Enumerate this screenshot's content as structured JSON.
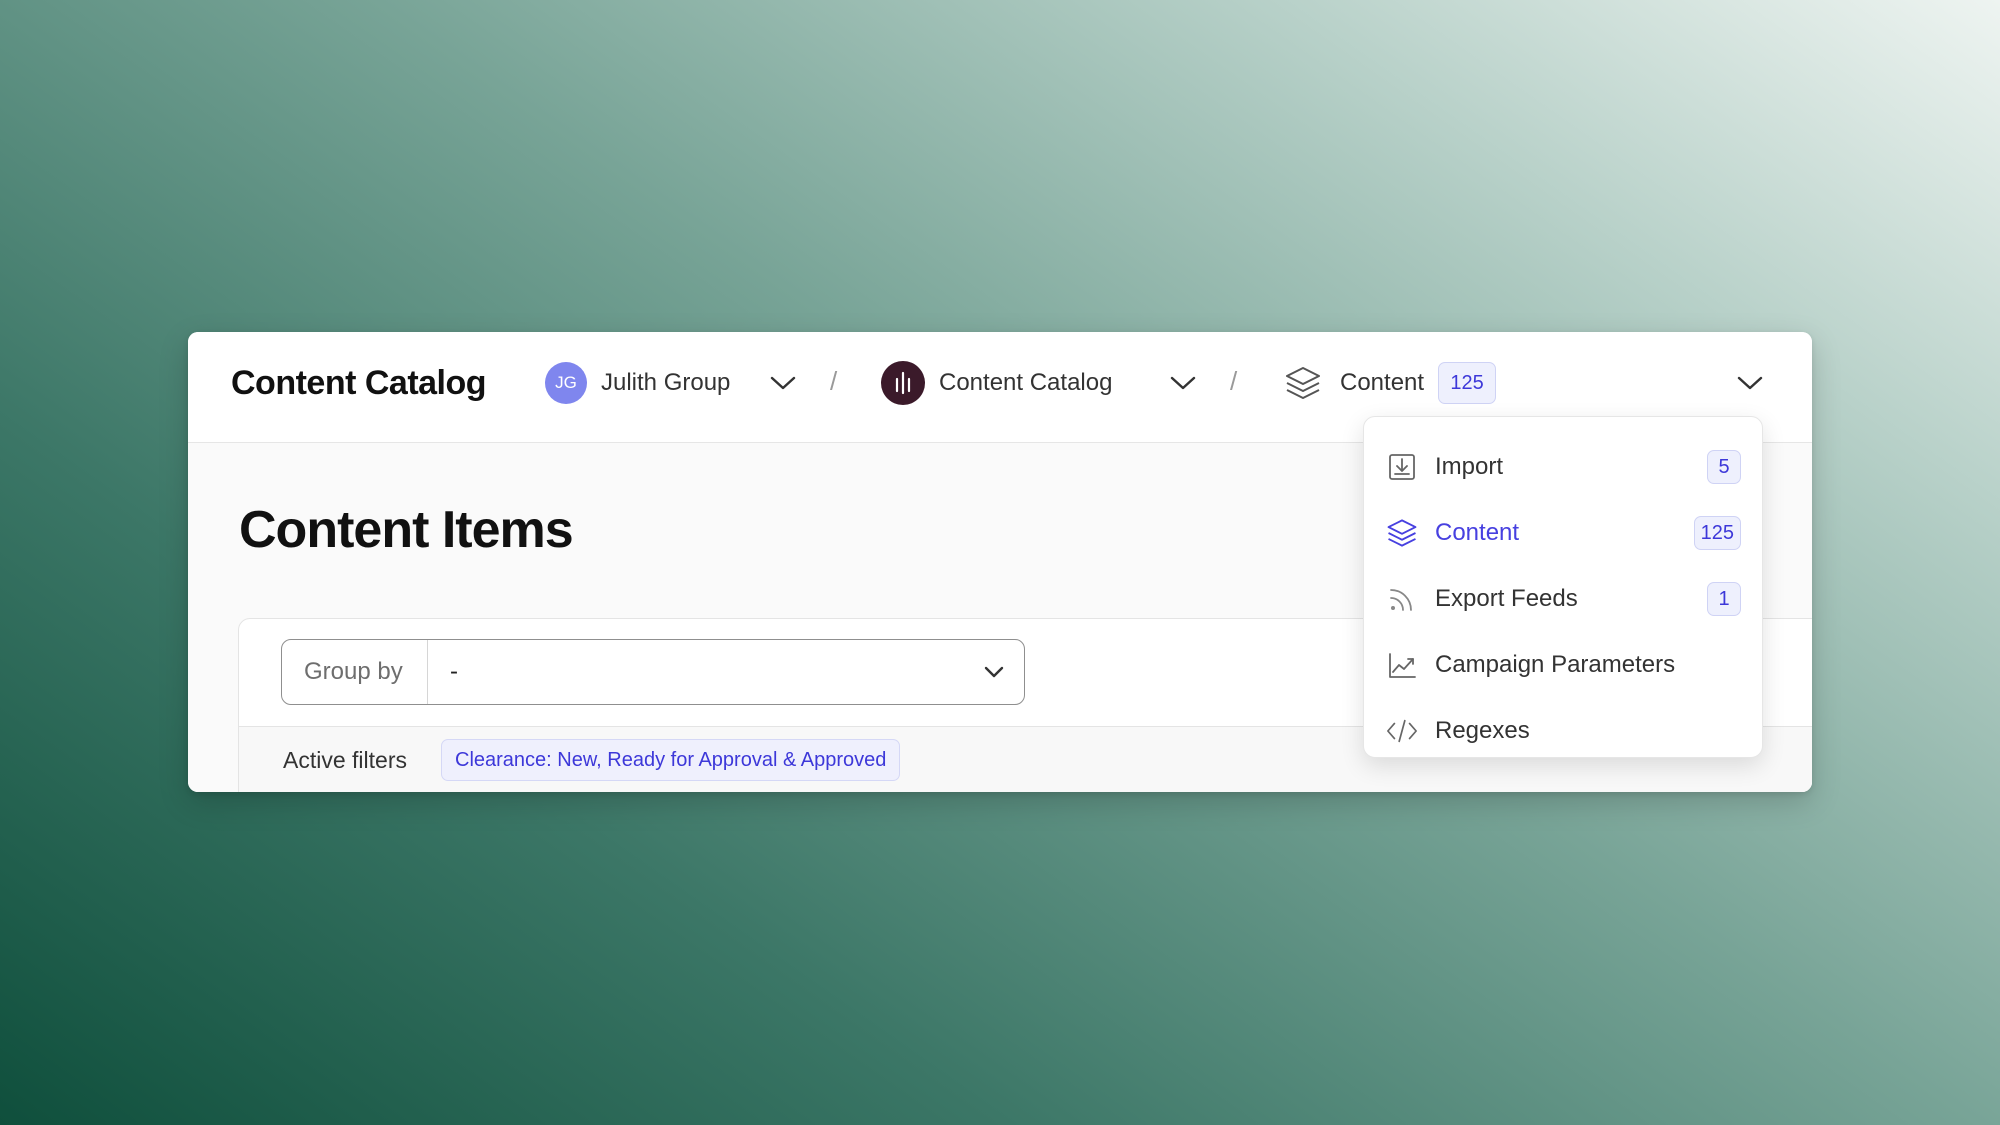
{
  "app": {
    "title": "Content Catalog"
  },
  "breadcrumb": {
    "group": {
      "initials": "JG",
      "label": "Julith Group"
    },
    "catalog": {
      "label": "Content Catalog"
    },
    "section": {
      "label": "Content",
      "count": "125"
    },
    "separator": "/"
  },
  "page": {
    "title": "Content Items"
  },
  "group_by": {
    "label": "Group by",
    "value": "-"
  },
  "filters": {
    "label": "Active filters",
    "chip": "Clearance: New, Ready for Approval & Approved"
  },
  "menu": {
    "items": [
      {
        "label": "Import",
        "count": "5",
        "icon": "import-icon",
        "active": false
      },
      {
        "label": "Content",
        "count": "125",
        "icon": "layers-icon",
        "active": true
      },
      {
        "label": "Export Feeds",
        "count": "1",
        "icon": "rss-feed-icon",
        "active": false
      },
      {
        "label": "Campaign Parameters",
        "icon": "chart-line-icon",
        "active": false
      },
      {
        "label": "Regexes",
        "icon": "code-icon",
        "active": false
      }
    ]
  },
  "colors": {
    "accent": "#4740e0",
    "badge_bg": "#eef0fd",
    "avatar_group": "#7f86ee",
    "avatar_catalog": "#3b1a2a"
  }
}
